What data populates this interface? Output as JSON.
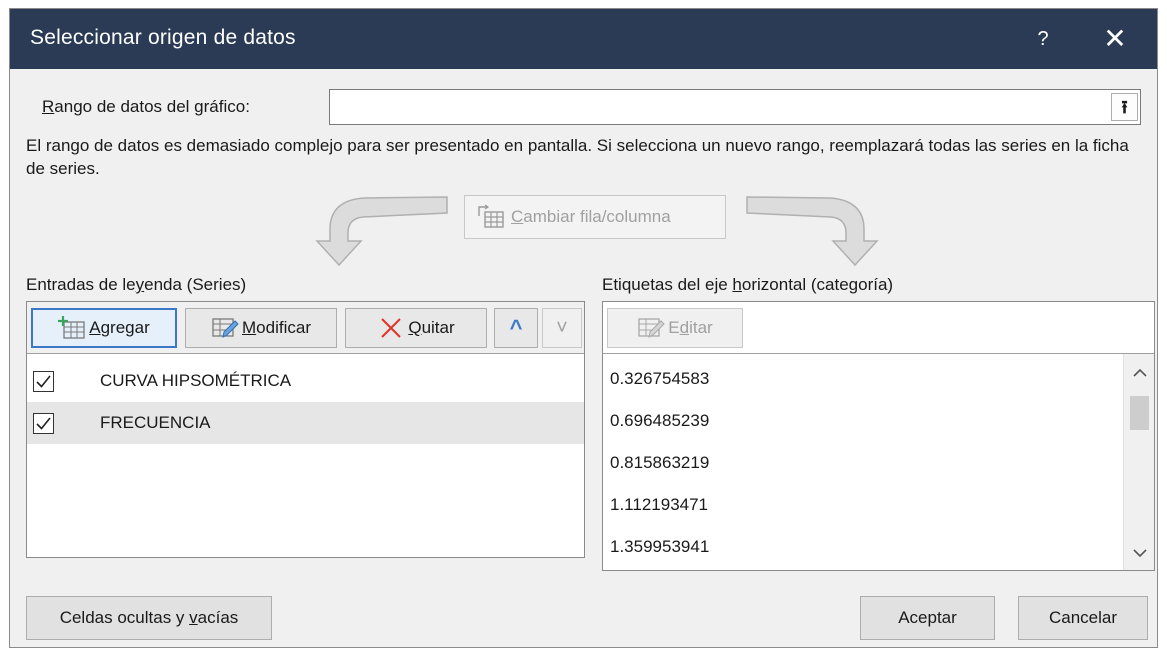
{
  "window": {
    "title": "Seleccionar origen de datos",
    "help": "?",
    "close": "✕"
  },
  "range": {
    "label_pre": "",
    "label_accel": "R",
    "label_rest": "ango de datos del gráfico:",
    "value": "",
    "collapse_glyph": "⭱"
  },
  "message": "El rango de datos es demasiado complejo para ser presentado en pantalla. Si selecciona un nuevo rango, reemplazará todas las series en la ficha de series.",
  "switch_button": {
    "accel": "C",
    "rest": "ambiar fila/columna"
  },
  "series_panel": {
    "label_pre": "Entradas de le",
    "label_accel": "y",
    "label_rest": "enda (Series)",
    "add": {
      "accel": "A",
      "rest": "gregar"
    },
    "edit": {
      "accel": "M",
      "rest": "odificar"
    },
    "remove": {
      "accel": "Q",
      "rest": "uitar"
    },
    "move_up": "^",
    "move_down": "˅",
    "items": [
      {
        "label": "CURVA HIPSOMÉTRICA",
        "checked": true,
        "selected": false
      },
      {
        "label": "FRECUENCIA",
        "checked": true,
        "selected": true
      }
    ]
  },
  "category_panel": {
    "label_pre": "Etiquetas del eje ",
    "label_accel": "h",
    "label_rest": "orizontal (categoría)",
    "edit": {
      "pre": "E",
      "accel": "d",
      "rest": "itar"
    },
    "values": [
      "0.326754583",
      "0.696485239",
      "0.815863219",
      "1.112193471",
      "1.359953941"
    ]
  },
  "footer": {
    "hidden_cells": {
      "pre": "Celdas ocultas y ",
      "accel": "v",
      "rest": "acías"
    },
    "ok": "Aceptar",
    "cancel": "Cancelar"
  },
  "colors": {
    "titlebar": "#2b3a55",
    "focus": "#3b79c8",
    "remove_x": "#e0342a",
    "arrow": "#3b79c8"
  }
}
